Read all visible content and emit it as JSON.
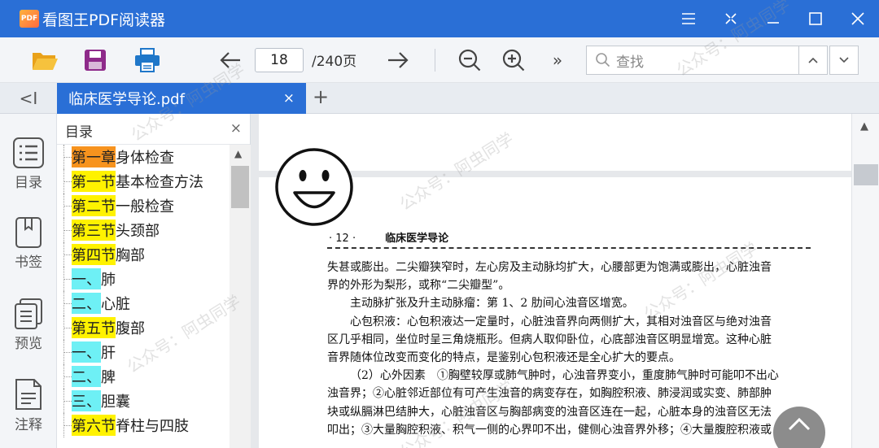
{
  "app": {
    "logo_text": "PDF",
    "title": "看图王PDF阅读器",
    "brand_color": "#2a6fd6"
  },
  "window_controls": {
    "menu_icon": "menu-icon",
    "minimize_icon": "minimize-icon",
    "maximize_icon": "maximize-icon",
    "close_icon": "close-icon"
  },
  "toolbar": {
    "open_icon": "folder-open-icon",
    "save_icon": "save-icon",
    "print_icon": "print-icon",
    "prev_icon": "arrow-left-icon",
    "current_page": "18",
    "page_total": "/240页",
    "next_icon": "arrow-right-icon",
    "zoom_out_icon": "zoom-out-icon",
    "zoom_in_icon": "zoom-in-icon",
    "more_label": "»",
    "search_placeholder": "查找",
    "search_prev_icon": "chevron-up-icon",
    "search_next_icon": "chevron-down-icon"
  },
  "tabs": {
    "collapse_label": "<I",
    "items": [
      {
        "label": "临床医学导论.pdf",
        "active": true
      }
    ],
    "close_label": "×",
    "add_label": "+"
  },
  "sidebar": {
    "items": [
      {
        "label": "目录",
        "icon": "list-icon"
      },
      {
        "label": "书签",
        "icon": "bookmark-icon"
      },
      {
        "label": "预览",
        "icon": "thumbnails-icon"
      },
      {
        "label": "注释",
        "icon": "annotation-icon"
      }
    ]
  },
  "outline": {
    "title": "目录",
    "close_label": "×",
    "items": [
      {
        "tag": "第一章",
        "text": "身体检查",
        "highlight": "orange"
      },
      {
        "tag": "第一节",
        "text": "基本检查方法",
        "highlight": "yellow"
      },
      {
        "tag": "第二节",
        "text": "一般检查",
        "highlight": "yellow"
      },
      {
        "tag": "第三节",
        "text": "头颈部",
        "highlight": "yellow"
      },
      {
        "tag": "第四节",
        "text": "胸部",
        "highlight": "yellow"
      },
      {
        "tag": "一、",
        "text": "肺",
        "highlight": "cyan"
      },
      {
        "tag": "二、",
        "text": "心脏",
        "highlight": "cyan"
      },
      {
        "tag": "第五节",
        "text": "腹部",
        "highlight": "yellow"
      },
      {
        "tag": "一、",
        "text": "肝",
        "highlight": "cyan"
      },
      {
        "tag": "二、",
        "text": "脾",
        "highlight": "cyan"
      },
      {
        "tag": "三、",
        "text": "胆囊",
        "highlight": "cyan"
      },
      {
        "tag": "第六节",
        "text": "脊柱与四肢",
        "highlight": "yellow"
      }
    ]
  },
  "document": {
    "page_number": "· 12 ·",
    "running_title": "临床医学导论",
    "lines": [
      "失甚或膨出。二尖瓣狭窄时，左心房及主动脉均扩大，心腰部更为饱满或膨出，心脏浊音",
      "界的外形为梨形，或称“二尖瓣型”。",
      "主动脉扩张及升主动脉瘤：第 1、2 肋间心浊音区增宽。",
      "心包积液：心包积液达一定量时，心脏浊音界向两侧扩大，其相对浊音区与绝对浊音",
      "区几乎相同，坐位时呈三角烧瓶形。但病人取仰卧位，心底部浊音区明显增宽。这种心脏",
      "音界随体位改变而变化的特点，是鉴别心包积液还是全心扩大的要点。",
      "（2）心外因素　①胸壁较厚或肺气肿时，心浊音界变小，重度肺气肿时可能叩不出心",
      "浊音界；②心脏邻近部位有可产生浊音的病变存在，如胸腔积液、肺浸润或实变、肺部肿",
      "块或纵膈淋巴结肿大，心脏浊音区与胸部病变的浊音区连在一起，心脏本身的浊音区无法",
      "叩出；③大量胸腔积液、积气一侧的心界叩不出，健侧心浊音界外移；④大量腹腔积液或"
    ],
    "indented_lines": [
      2,
      3,
      6
    ]
  },
  "watermark": {
    "text": "公众号：阿虫同学"
  },
  "highlight_colors": {
    "orange": "#f7931e",
    "yellow": "#fff200",
    "cyan": "#6ef0f5"
  }
}
